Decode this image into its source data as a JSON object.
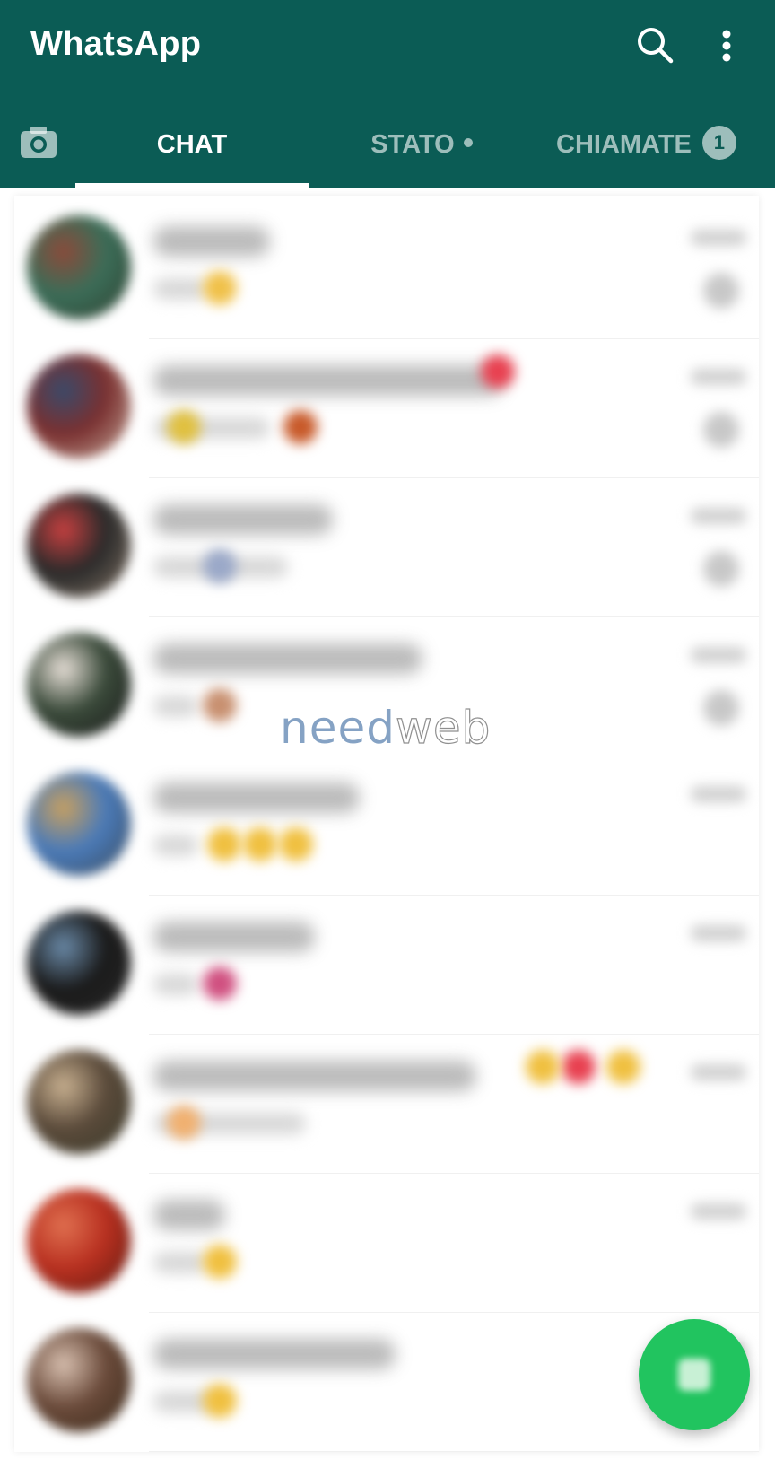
{
  "app": {
    "title": "WhatsApp"
  },
  "tabs": [
    {
      "label": "CHAT",
      "active": true
    },
    {
      "label": "STATO",
      "has_dot": true
    },
    {
      "label": "CHIAMATE",
      "badge": "1"
    }
  ],
  "icons": {
    "search": "search-icon",
    "menu": "more-vert-icon",
    "camera": "camera-icon",
    "fab": "new-chat-icon"
  },
  "colors": {
    "toolbar": "#0b5c55",
    "fab": "#21c45f",
    "tab_active": "#ffffff",
    "tab_inactive": "#9dbeb9"
  },
  "watermark": {
    "part1": "need",
    "part2": "web"
  },
  "chat_list": [
    {
      "avatar_colors": [
        "#3b6d58",
        "#8b4a3a",
        "#2f3f2f"
      ],
      "name_width": 130,
      "msg_width": 60,
      "emojis": [
        [
          "#f0c14a",
          210
        ]
      ],
      "muted": true
    },
    {
      "avatar_colors": [
        "#7a3030",
        "#3a4a6a",
        "#c9b0a0"
      ],
      "name_width": 390,
      "msg_width": 130,
      "emojis": [
        [
          "#e0c040",
          170
        ],
        [
          "#e84050",
          520
        ],
        [
          "#c85a2a",
          300
        ]
      ],
      "muted": true
    },
    {
      "avatar_colors": [
        "#2a2a2a",
        "#c84040",
        "#8a7a6a"
      ],
      "name_width": 200,
      "msg_width": 150,
      "emojis": [
        [
          "#9aa8c8",
          210
        ]
      ],
      "muted": true
    },
    {
      "avatar_colors": [
        "#3a4a3a",
        "#e8e0d8",
        "#1a1a1a"
      ],
      "name_width": 300,
      "msg_width": 50,
      "emojis": [
        [
          "#c89070",
          210
        ]
      ],
      "muted": true
    },
    {
      "avatar_colors": [
        "#4a7ab8",
        "#c8a060",
        "#3a4a5a"
      ],
      "name_width": 230,
      "msg_width": 50,
      "emojis": [
        [
          "#f0c040",
          215
        ],
        [
          "#f0c040",
          255
        ],
        [
          "#f0c040",
          295
        ]
      ],
      "muted": false
    },
    {
      "avatar_colors": [
        "#1a1a1a",
        "#6a8aa8",
        "#2a2a2a"
      ],
      "name_width": 180,
      "msg_width": 50,
      "emojis": [
        [
          "#d05080",
          210
        ]
      ],
      "muted": false
    },
    {
      "avatar_colors": [
        "#5a4a3a",
        "#c8b090",
        "#3a3a2a"
      ],
      "name_width": 360,
      "msg_width": 170,
      "emojis": [
        [
          "#f0b070",
          170
        ],
        [
          "#e84050",
          610
        ],
        [
          "#f0c040",
          570
        ],
        [
          "#f0c040",
          660
        ]
      ],
      "muted": false
    },
    {
      "avatar_colors": [
        "#b83020",
        "#e07050",
        "#5a1a10"
      ],
      "name_width": 80,
      "msg_width": 60,
      "emojis": [
        [
          "#f0c040",
          210
        ]
      ],
      "muted": false
    },
    {
      "avatar_colors": [
        "#6a4a3a",
        "#d8c0b0",
        "#3a2a1a"
      ],
      "name_width": 270,
      "msg_width": 70,
      "emojis": [
        [
          "#f0c040",
          210
        ]
      ],
      "muted": false
    }
  ]
}
